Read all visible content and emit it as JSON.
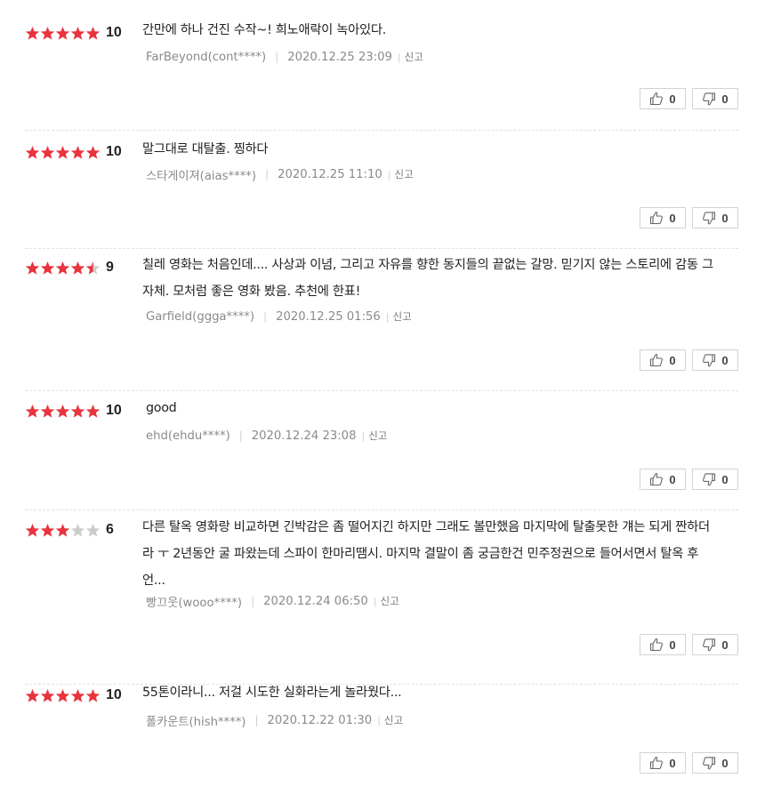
{
  "colors": {
    "star_on": "#e8343f",
    "star_off": "#cccccc",
    "meta_gray": "#8a8a8a"
  },
  "icons": {
    "like": "thumbs-up-icon",
    "dislike": "thumbs-down-icon",
    "star": "star-icon"
  },
  "report_label": "신고",
  "reviews": [
    {
      "stars": 5,
      "score": "10",
      "text": "간만에 하나 건진 수작~! 희노애락이 녹아있다.",
      "author": "FarBeyond(cont****)",
      "date": "2020.12.25 23:09",
      "likes": "0",
      "dislikes": "0"
    },
    {
      "stars": 5,
      "score": "10",
      "text": "말그대로 대탈출. 찡하다",
      "author": "스타게이져(aias****)",
      "date": "2020.12.25 11:10",
      "likes": "0",
      "dislikes": "0"
    },
    {
      "stars": 4.5,
      "score": "9",
      "text": "칠레 영화는 처음인데.... 사상과 이념, 그리고 자유를 향한 동지들의 끝없는 갈망. 믿기지 않는 스토리에 감동 그 자체. 모처럼 좋은 영화 봤음. 추천에 한표!",
      "author": "Garfield(ggga****)",
      "date": "2020.12.25 01:56",
      "likes": "0",
      "dislikes": "0"
    },
    {
      "stars": 5,
      "score": "10",
      "text": "good",
      "author": "ehd(ehdu****)",
      "date": "2020.12.24 23:08",
      "likes": "0",
      "dislikes": "0"
    },
    {
      "stars": 3,
      "score": "6",
      "text": "다른 탈옥 영화랑 비교하면 긴박감은 좀 떨어지긴 하지만 그래도 볼만했음 마지막에 탈출못한 걔는 되게 짠하더라 ㅜ 2년동안 굴 파왔는데 스파이 한마리땜시. 마지막 결말이 좀 궁금한건 민주정권으로 들어서면서 탈옥 후 언...",
      "author": "빵끄웃(wooo****)",
      "date": "2020.12.24 06:50",
      "likes": "0",
      "dislikes": "0"
    },
    {
      "stars": 5,
      "score": "10",
      "text": "55톤이라니... 저걸 시도한 실화라는게 놀라웠다...",
      "author": "폴카운트(hish****)",
      "date": "2020.12.22 01:30",
      "likes": "0",
      "dislikes": "0"
    }
  ]
}
